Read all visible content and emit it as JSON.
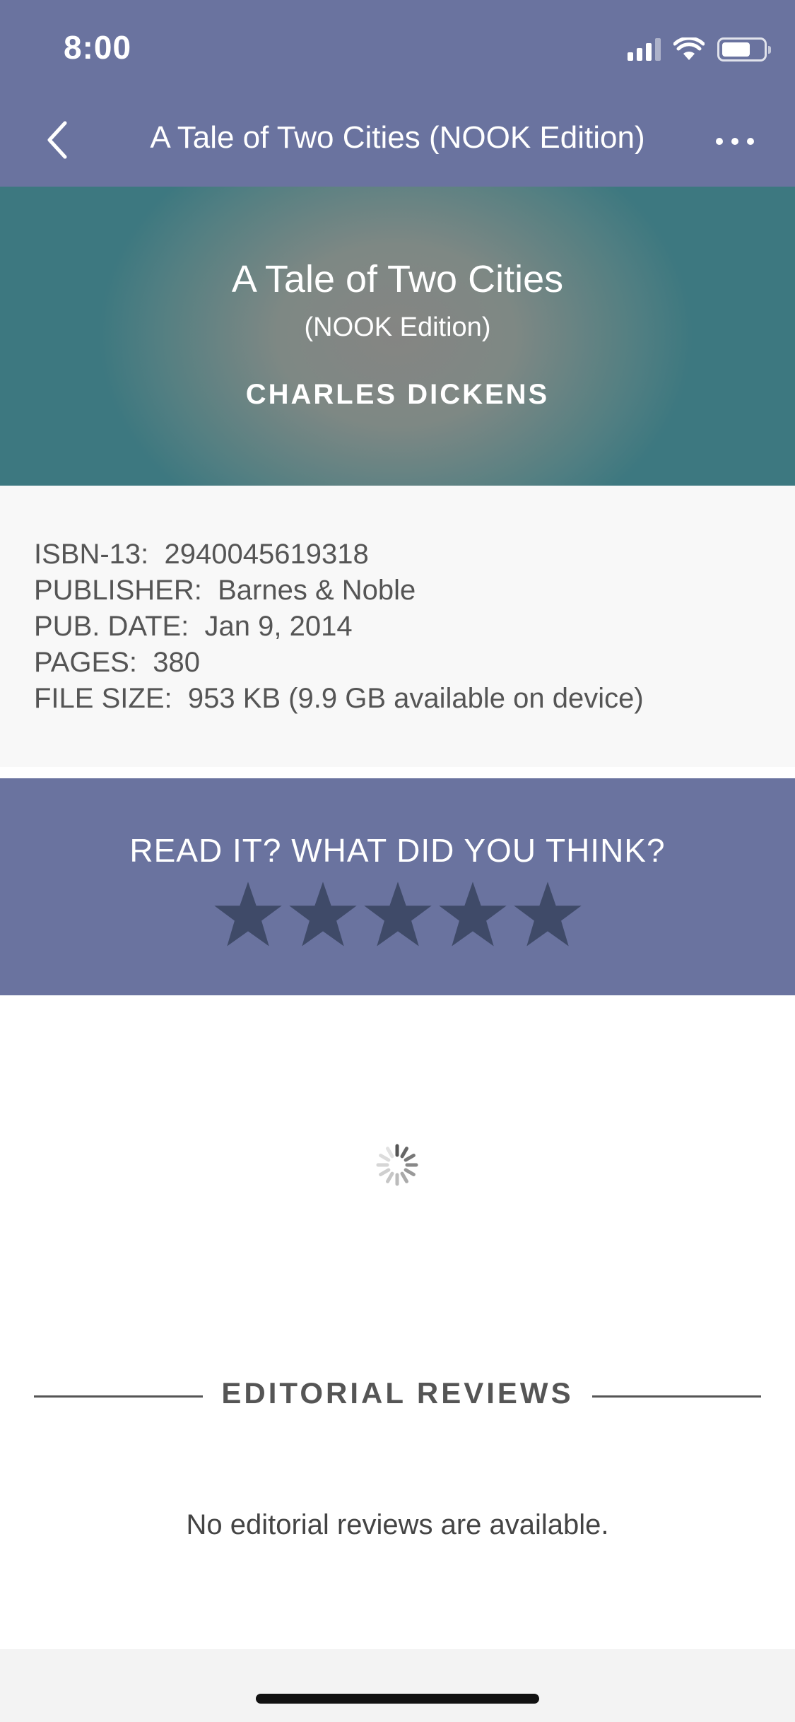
{
  "status_bar": {
    "time": "8:00"
  },
  "nav": {
    "title": "A Tale of Two Cities (NOOK Edition)"
  },
  "hero": {
    "title": "A Tale of Two Cities",
    "subtitle": "(NOOK Edition)",
    "author": "CHARLES DICKENS"
  },
  "details": [
    {
      "label": "ISBN-13:",
      "value": "2940045619318"
    },
    {
      "label": "PUBLISHER:",
      "value": "Barnes & Noble"
    },
    {
      "label": "PUB. DATE:",
      "value": "Jan 9, 2014"
    },
    {
      "label": "PAGES:",
      "value": "380"
    },
    {
      "label": "FILE SIZE:",
      "value": "953 KB (9.9 GB available on device)"
    }
  ],
  "rating": {
    "prompt": "READ IT? WHAT DID YOU THINK?",
    "max_stars": 5,
    "selected_stars": 0
  },
  "reviews": {
    "title": "EDITORIAL REVIEWS",
    "empty_message": "No editorial reviews are available."
  },
  "colors": {
    "bar_purple": "#6a739f",
    "star_color": "#3f4a68",
    "hero_teal": "#3d7880"
  }
}
